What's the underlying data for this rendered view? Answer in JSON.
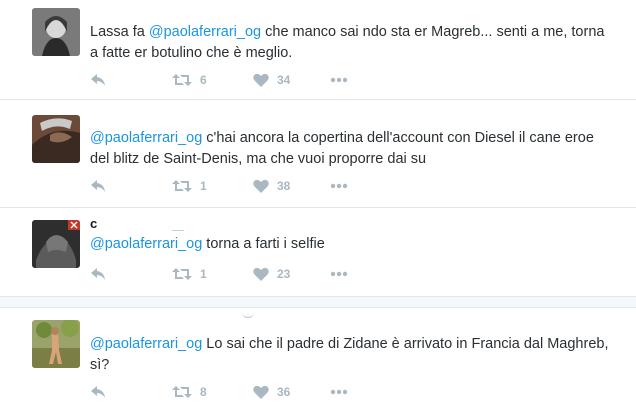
{
  "tweets": [
    {
      "user_name": "",
      "mention": "@paolaferrari_og",
      "text_before": "Lassa fa ",
      "text_after": " che manco sai ndo sta er Magreb... senti a me, torna a fatte er botulino che è meglio.",
      "retweets": "6",
      "likes": "34"
    },
    {
      "user_name": "",
      "mention": "@paolaferrari_og",
      "text_before": "",
      "text_after": " c'hai ancora la copertina dell'account con Diesel il cane eroe del blitz de Saint-Denis, ma che vuoi proporre dai su",
      "retweets": "1",
      "likes": "38"
    },
    {
      "user_name": "c",
      "mention": "@paolaferrari_og",
      "text_before": "",
      "text_after": " torna a farti i selfie",
      "retweets": "1",
      "likes": "23"
    },
    {
      "user_name": "",
      "mention": "@paolaferrari_og",
      "text_before": "",
      "text_after": " Lo sai che il padre di Zidane è arrivato in Francia dal Maghreb, sì?",
      "retweets": "8",
      "likes": "36"
    }
  ],
  "icons": {
    "reply": "reply-icon",
    "retweet": "retweet-icon",
    "like": "heart-icon",
    "more": "more-icon"
  },
  "colors": {
    "mention": "#1b95e0",
    "action_gray": "#aab8c2",
    "text": "#292f33",
    "divider": "#e1e8ed"
  }
}
